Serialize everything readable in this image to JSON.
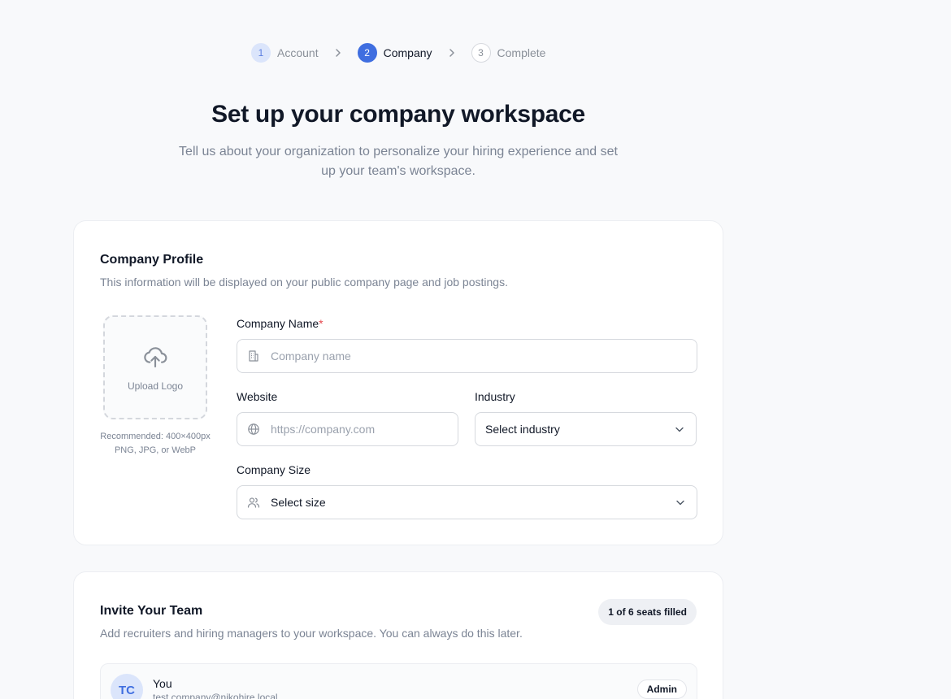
{
  "stepper": {
    "steps": [
      {
        "num": "1",
        "label": "Account"
      },
      {
        "num": "2",
        "label": "Company"
      },
      {
        "num": "3",
        "label": "Complete"
      }
    ]
  },
  "header": {
    "title": "Set up your company workspace",
    "subtitle": "Tell us about your organization to personalize your hiring experience and set up your team's workspace."
  },
  "profile": {
    "title": "Company Profile",
    "description": "This information will be displayed on your public company page and job postings.",
    "upload_label": "Upload Logo",
    "upload_hint_1": "Recommended: 400×400px",
    "upload_hint_2": "PNG, JPG, or WebP",
    "company_name_label": "Company Name",
    "required_mark": "*",
    "company_name_placeholder": "Company name",
    "company_name_value": "",
    "website_label": "Website",
    "website_placeholder": "https://company.com",
    "website_value": "",
    "industry_label": "Industry",
    "industry_value": "Select industry",
    "size_label": "Company Size",
    "size_value": "Select size"
  },
  "team": {
    "title": "Invite Your Team",
    "description": "Add recruiters and hiring managers to your workspace. You can always do this later.",
    "seats_badge": "1 of 6 seats filled",
    "members": [
      {
        "initials": "TC",
        "name": "You",
        "email": "test.company@nikohire.local",
        "role": "Admin"
      }
    ]
  },
  "colors": {
    "accent": "#3f6ee0",
    "required": "#e5484d"
  },
  "icons": [
    "chevron-right-icon",
    "upload-cloud-icon",
    "building-icon",
    "globe-icon",
    "chevron-down-icon",
    "users-icon"
  ]
}
